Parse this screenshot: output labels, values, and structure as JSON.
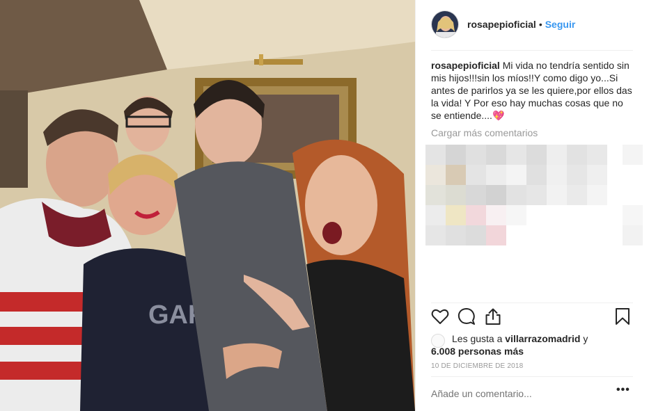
{
  "post": {
    "username": "rosapepioficial",
    "separator": "•",
    "follow_label": "Seguir",
    "caption_user": "rosapepioficial",
    "caption_text": " Mi vida no tendría sentido sin mis hijos!!!sin los míos!!Y como digo yo...Si antes de parirlos ya se les quiere,por ellos das la vida! Y Por eso hay muchas cosas que no se entiende....💖",
    "load_more_comments": "Cargar más comentarios",
    "likes_prefix": "Les gusta a ",
    "likes_user": "villarrazomadrid",
    "likes_joiner": " y",
    "likes_others": "6.008 personas más",
    "date": "10 DE DICIEMBRE DE 2018",
    "comment_placeholder": "Añade un comentario...",
    "more_label": "•••",
    "photo_overlay_text": "GAP"
  },
  "icons": {
    "like": "heart-icon",
    "comment": "comment-bubble-icon",
    "share": "share-icon",
    "save": "bookmark-icon",
    "more": "ellipsis-icon"
  },
  "colors": {
    "link": "#3897f0",
    "text": "#262626",
    "muted": "#999999",
    "heart_emoji": "#ff3b8d"
  }
}
